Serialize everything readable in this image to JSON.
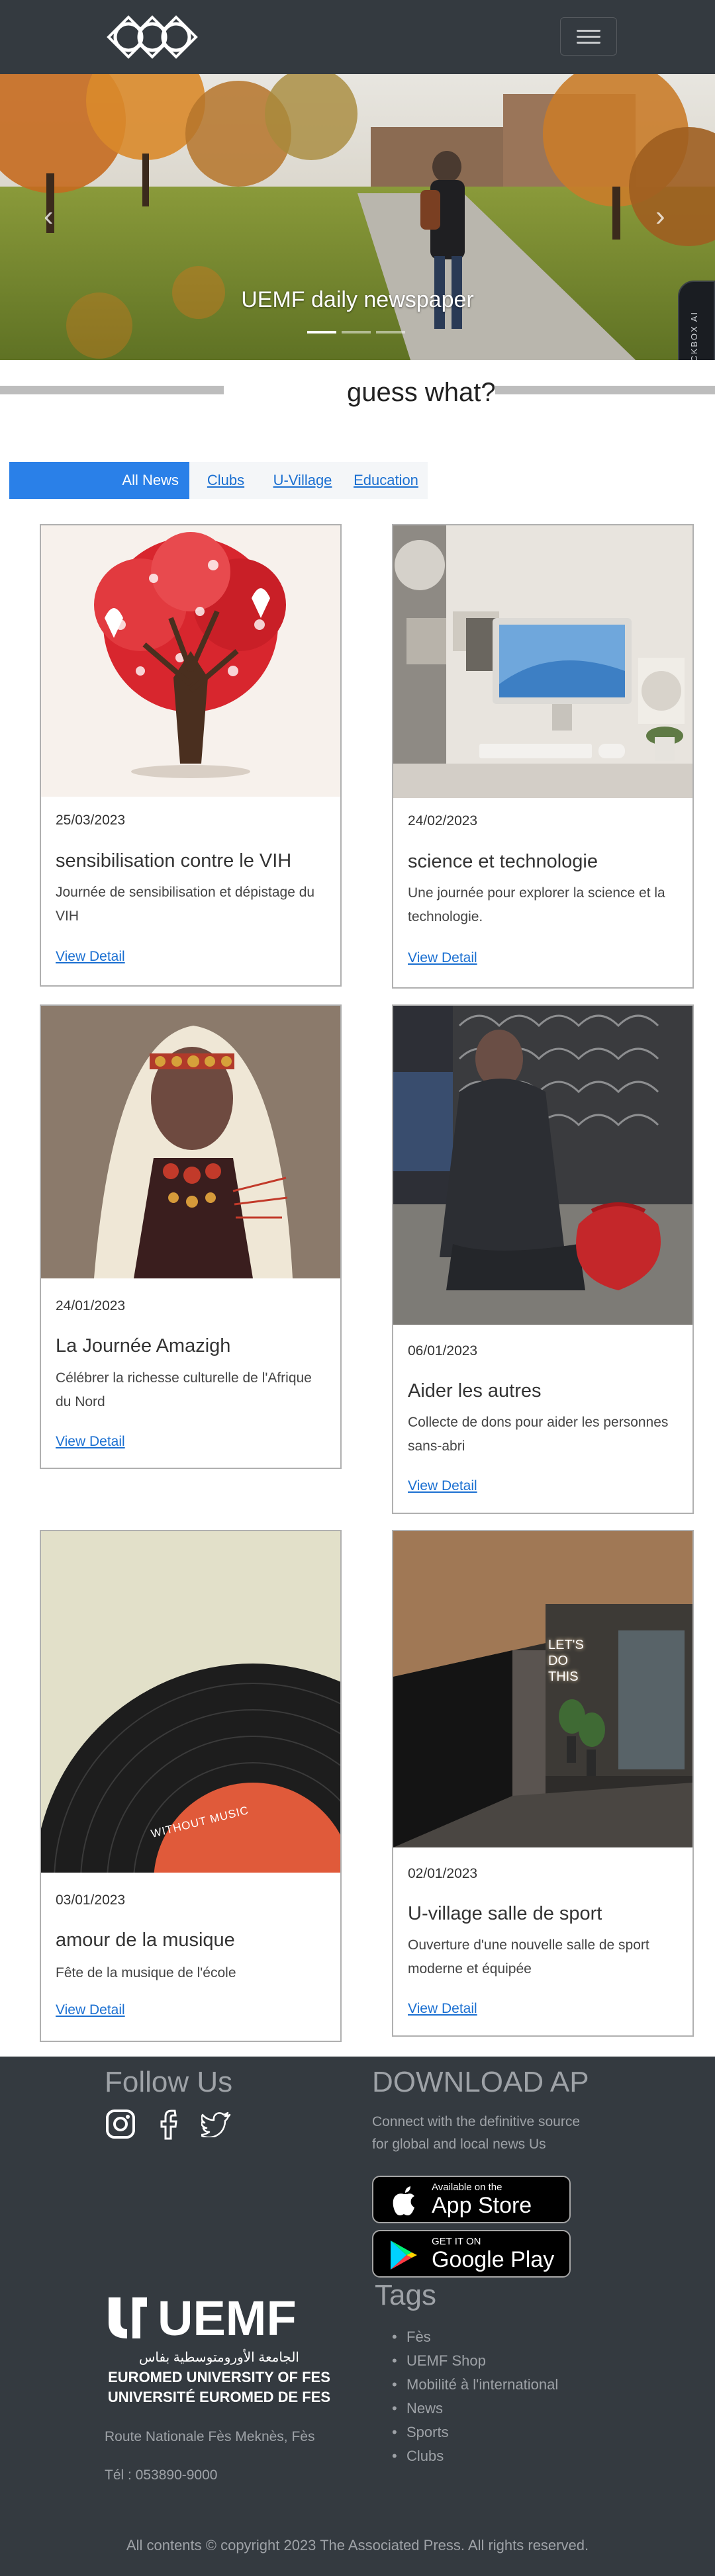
{
  "hero": {
    "caption": "UEMF daily newspaper",
    "slides": 3,
    "active_slide": 1,
    "widget_label": "BLACKBOX AI"
  },
  "section": {
    "title": "guess what?"
  },
  "tabs": [
    "All News",
    "Clubs",
    "U-Village",
    "Education"
  ],
  "active_tab": 0,
  "cards": [
    {
      "date": "25/03/2023",
      "title": "sensibilisation contre le VIH",
      "description": "Journée de sensibilisation et dépistage du VIH",
      "link": "View Detail",
      "image": "red-ribbon-tree-illustration"
    },
    {
      "date": "24/02/2023",
      "title": "science et technologie",
      "description": "Une journée pour explorer la science et la technologie.",
      "link": "View Detail",
      "image": "desk-computer-photo"
    },
    {
      "date": "24/01/2023",
      "title": "La Journée Amazigh",
      "description": "Célébrer la richesse culturelle de l'Afrique du Nord",
      "link": "View Detail",
      "image": "amazigh-woman-illustration"
    },
    {
      "date": "06/01/2023",
      "title": "Aider les autres",
      "description": "Collecte de dons pour aider les personnes sans-abri",
      "link": "View Detail",
      "image": "person-sitting-street-photo"
    },
    {
      "date": "03/01/2023",
      "title": "amour de la musique",
      "description": "Fête de la musique de l'école",
      "link": "View Detail",
      "image": "vinyl-record-illustration",
      "record_label": "WITHOUT MUSIC"
    },
    {
      "date": "02/01/2023",
      "title": "U-village salle de sport",
      "description": "Ouverture d'une nouvelle salle de sport moderne et équipée",
      "link": "View Detail",
      "image": "gym-photo",
      "neon_sign": "LET'S DO THIS"
    }
  ],
  "footer": {
    "follow_title": "Follow Us",
    "social": [
      "instagram-icon",
      "facebook-icon",
      "twitter-icon"
    ],
    "download_title": "DOWNLOAD AP",
    "download_text_1": "Connect with the definitive source",
    "download_text_2": "for global and local news Us",
    "app_store_small": "Available on the",
    "app_store_big": "App Store",
    "google_small": "GET IT ON",
    "google_big": "Google Play",
    "logo_text": "UEMF",
    "logo_arabic": "الجامعة الأورومتوسطية بفاس",
    "logo_line_1": "EUROMED UNIVERSITY OF FES",
    "logo_line_2": "UNIVERSITÉ EUROMED DE FES",
    "address": "Route Nationale Fès Meknès, Fès",
    "phone": "Tél : 053890-9000",
    "tags_title": "Tags",
    "tags": [
      "Fès",
      "UEMF Shop",
      "Mobilité à l'international",
      "News",
      "Sports",
      "Clubs"
    ],
    "copyright": "All contents © copyright 2023 The Associated Press. All rights reserved."
  }
}
